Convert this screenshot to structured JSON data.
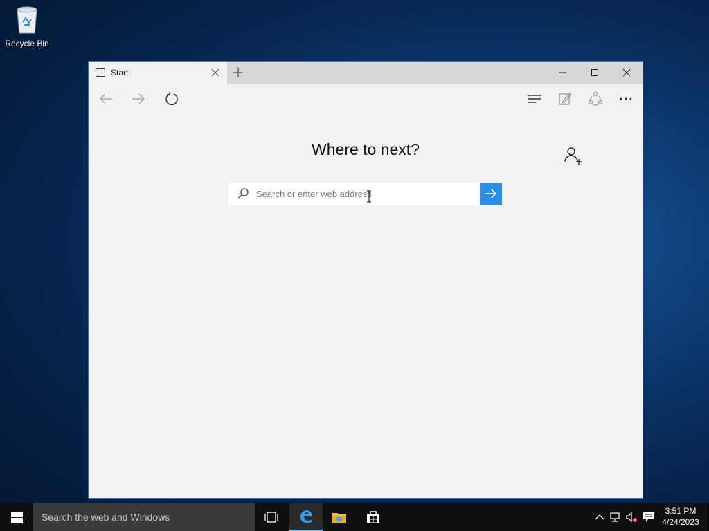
{
  "desktop": {
    "icons": [
      {
        "label": "Recycle Bin",
        "icon": "recycle-bin-icon"
      }
    ]
  },
  "browser": {
    "tab": {
      "title": "Start",
      "icon": "page-icon"
    },
    "new_tab_icon": "plus-icon",
    "window_controls": [
      "minimize-icon",
      "maximize-icon",
      "close-icon"
    ],
    "toolbar": {
      "left": [
        "back-arrow-icon",
        "forward-arrow-icon",
        "refresh-icon"
      ],
      "right": [
        "hub-icon",
        "web-note-icon",
        "share-icon",
        "more-icon"
      ]
    },
    "page": {
      "heading": "Where to next?",
      "search_placeholder": "Search or enter web address",
      "search_value": "",
      "go_icon": "arrow-right-icon",
      "accent": "#2b8de6"
    }
  },
  "taskbar": {
    "search_placeholder": "Search the web and Windows",
    "apps": [
      "task-view-icon",
      "edge-icon",
      "file-explorer-icon",
      "store-icon"
    ],
    "active_app": "edge-icon",
    "tray": [
      "chevron-up-icon",
      "network-icon",
      "volume-muted-icon",
      "action-center-icon"
    ],
    "time": "3:51 PM",
    "date": "4/24/2023"
  }
}
